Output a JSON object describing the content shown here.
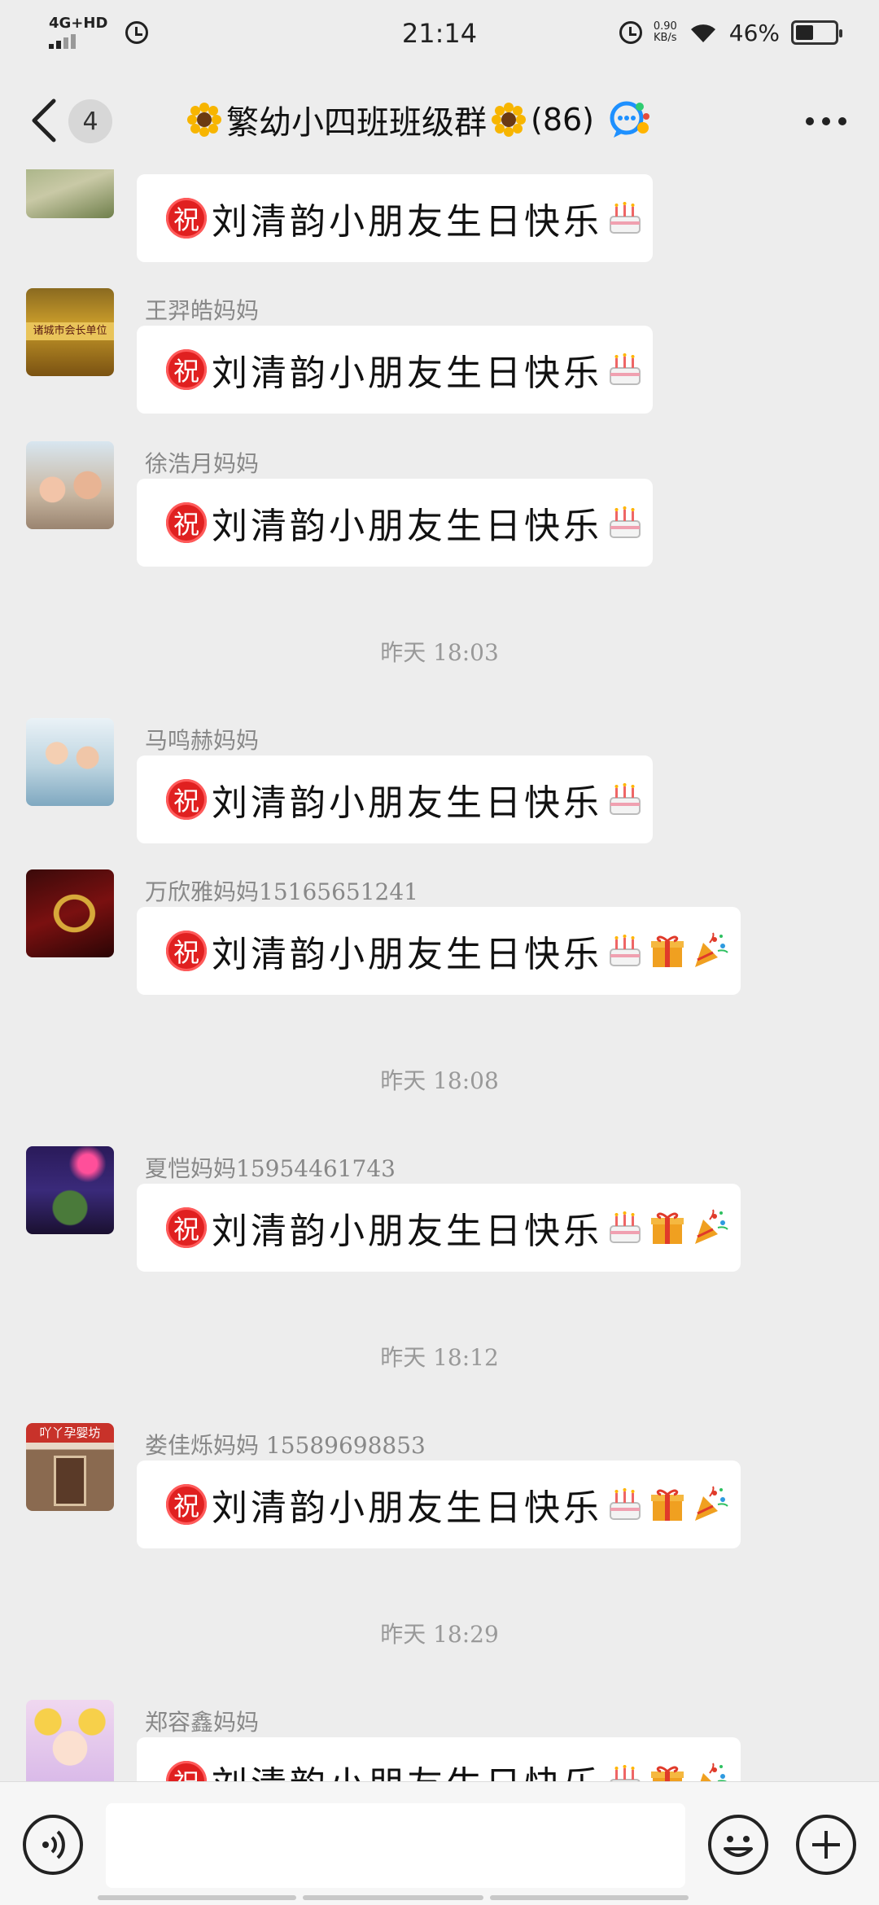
{
  "status_bar": {
    "network": "4G+HD",
    "time": "21:14",
    "speed_value": "0.90",
    "speed_unit": "KB/s",
    "battery": "46%",
    "battery_level": 0.46
  },
  "header": {
    "unread_count": "4",
    "group_name": "繁幼小四班班级群",
    "member_count": "(86)"
  },
  "messages": [
    {
      "sender": "",
      "text": "刘清韵小朋友生日快乐",
      "emojis": [
        "cake-icon"
      ]
    },
    {
      "sender": "王羿皓妈妈",
      "text": "刘清韵小朋友生日快乐",
      "emojis": [
        "cake-icon"
      ]
    },
    {
      "sender": "徐浩月妈妈",
      "text": "刘清韵小朋友生日快乐",
      "emojis": [
        "cake-icon"
      ]
    },
    {
      "sender": "马鸣赫妈妈",
      "text": "刘清韵小朋友生日快乐",
      "emojis": [
        "cake-icon"
      ]
    },
    {
      "sender": "万欣雅妈妈15165651241",
      "text": "刘清韵小朋友生日快乐",
      "emojis": [
        "cake-icon",
        "gift-icon",
        "party-popper-icon"
      ]
    },
    {
      "sender": "夏恺妈妈15954461743",
      "text": "刘清韵小朋友生日快乐",
      "emojis": [
        "cake-icon",
        "gift-icon",
        "party-popper-icon"
      ]
    },
    {
      "sender": "娄佳烁妈妈 15589698853",
      "text": "刘清韵小朋友生日快乐",
      "emojis": [
        "cake-icon",
        "gift-icon",
        "party-popper-icon"
      ]
    },
    {
      "sender": "郑容鑫妈妈",
      "text": "刘清韵小朋友生日快乐",
      "emojis": [
        "cake-icon",
        "gift-icon",
        "party-popper-icon"
      ]
    }
  ],
  "zhu_badge": "祝",
  "avatar_texts": {
    "a2": "诸城市会长单位",
    "a7": "吖丫孕婴坊"
  },
  "time_separators": [
    "昨天 18:03",
    "昨天 18:08",
    "昨天 18:12",
    "昨天 18:29"
  ],
  "input": {
    "placeholder": ""
  }
}
